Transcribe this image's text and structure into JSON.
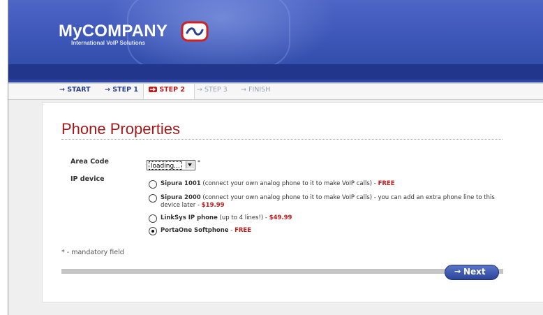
{
  "header": {
    "logo_name": "MyCOMPANY",
    "logo_tagline": "International VoIP Solutions",
    "colors": {
      "primary": "#3d57b8",
      "accent": "#c01a1a"
    }
  },
  "nav": {
    "arrow": "→",
    "active_arrow_icon": "arrow-right-red-icon",
    "steps": [
      {
        "label": "START",
        "state": "done"
      },
      {
        "label": "STEP 1",
        "state": "done"
      },
      {
        "label": "STEP 2",
        "state": "active"
      },
      {
        "label": "STEP 3",
        "state": "disabled"
      },
      {
        "label": "FINISH",
        "state": "disabled"
      }
    ]
  },
  "form": {
    "title": "Phone Properties",
    "area_code_label": "Area Code",
    "area_code_value": "loading...",
    "mandatory_mark": "*",
    "ip_device_label": "IP device",
    "options": [
      {
        "name": "Sipura 1001",
        "desc": " (connect your own analog phone to it to make VoIP calls) - ",
        "price": "FREE",
        "selected": false
      },
      {
        "name": "Sipura 2000",
        "desc": " (connect your own analog phone to it to make VoIP calls) - you can add an extra phone line to this device later - ",
        "price": "$19.99",
        "selected": false
      },
      {
        "name": "LinkSys IP phone",
        "desc": " (up to 4 lines!) - ",
        "price": "$49.99",
        "selected": false
      },
      {
        "name": "PortaOne Softphone",
        "desc": " - ",
        "price": "FREE",
        "selected": true
      }
    ],
    "footnote": "* - mandatory field",
    "next_label": "Next",
    "next_arrow": "→"
  }
}
